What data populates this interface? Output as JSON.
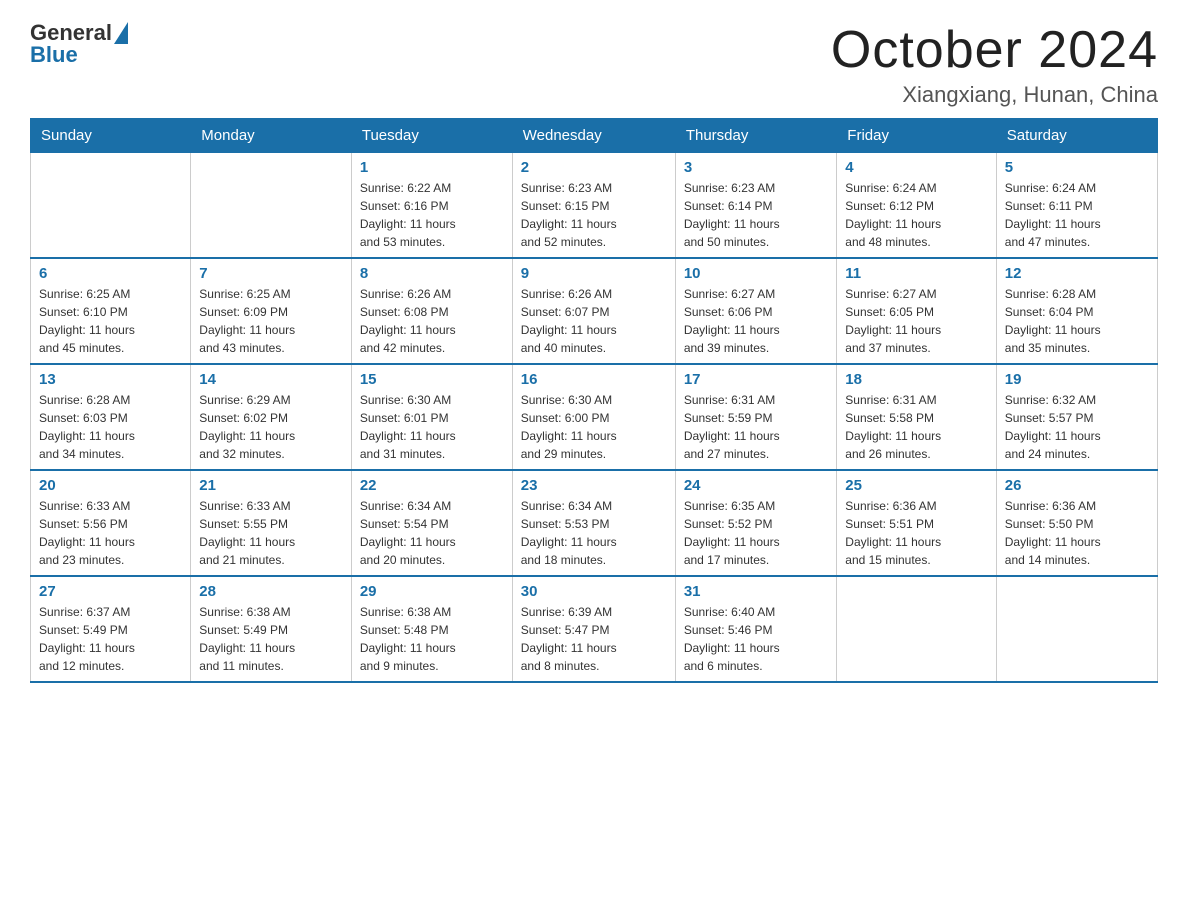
{
  "logo": {
    "general": "General",
    "blue": "Blue"
  },
  "header": {
    "title": "October 2024",
    "subtitle": "Xiangxiang, Hunan, China"
  },
  "days_of_week": [
    "Sunday",
    "Monday",
    "Tuesday",
    "Wednesday",
    "Thursday",
    "Friday",
    "Saturday"
  ],
  "weeks": [
    [
      {
        "day": "",
        "info": ""
      },
      {
        "day": "",
        "info": ""
      },
      {
        "day": "1",
        "info": "Sunrise: 6:22 AM\nSunset: 6:16 PM\nDaylight: 11 hours\nand 53 minutes."
      },
      {
        "day": "2",
        "info": "Sunrise: 6:23 AM\nSunset: 6:15 PM\nDaylight: 11 hours\nand 52 minutes."
      },
      {
        "day": "3",
        "info": "Sunrise: 6:23 AM\nSunset: 6:14 PM\nDaylight: 11 hours\nand 50 minutes."
      },
      {
        "day": "4",
        "info": "Sunrise: 6:24 AM\nSunset: 6:12 PM\nDaylight: 11 hours\nand 48 minutes."
      },
      {
        "day": "5",
        "info": "Sunrise: 6:24 AM\nSunset: 6:11 PM\nDaylight: 11 hours\nand 47 minutes."
      }
    ],
    [
      {
        "day": "6",
        "info": "Sunrise: 6:25 AM\nSunset: 6:10 PM\nDaylight: 11 hours\nand 45 minutes."
      },
      {
        "day": "7",
        "info": "Sunrise: 6:25 AM\nSunset: 6:09 PM\nDaylight: 11 hours\nand 43 minutes."
      },
      {
        "day": "8",
        "info": "Sunrise: 6:26 AM\nSunset: 6:08 PM\nDaylight: 11 hours\nand 42 minutes."
      },
      {
        "day": "9",
        "info": "Sunrise: 6:26 AM\nSunset: 6:07 PM\nDaylight: 11 hours\nand 40 minutes."
      },
      {
        "day": "10",
        "info": "Sunrise: 6:27 AM\nSunset: 6:06 PM\nDaylight: 11 hours\nand 39 minutes."
      },
      {
        "day": "11",
        "info": "Sunrise: 6:27 AM\nSunset: 6:05 PM\nDaylight: 11 hours\nand 37 minutes."
      },
      {
        "day": "12",
        "info": "Sunrise: 6:28 AM\nSunset: 6:04 PM\nDaylight: 11 hours\nand 35 minutes."
      }
    ],
    [
      {
        "day": "13",
        "info": "Sunrise: 6:28 AM\nSunset: 6:03 PM\nDaylight: 11 hours\nand 34 minutes."
      },
      {
        "day": "14",
        "info": "Sunrise: 6:29 AM\nSunset: 6:02 PM\nDaylight: 11 hours\nand 32 minutes."
      },
      {
        "day": "15",
        "info": "Sunrise: 6:30 AM\nSunset: 6:01 PM\nDaylight: 11 hours\nand 31 minutes."
      },
      {
        "day": "16",
        "info": "Sunrise: 6:30 AM\nSunset: 6:00 PM\nDaylight: 11 hours\nand 29 minutes."
      },
      {
        "day": "17",
        "info": "Sunrise: 6:31 AM\nSunset: 5:59 PM\nDaylight: 11 hours\nand 27 minutes."
      },
      {
        "day": "18",
        "info": "Sunrise: 6:31 AM\nSunset: 5:58 PM\nDaylight: 11 hours\nand 26 minutes."
      },
      {
        "day": "19",
        "info": "Sunrise: 6:32 AM\nSunset: 5:57 PM\nDaylight: 11 hours\nand 24 minutes."
      }
    ],
    [
      {
        "day": "20",
        "info": "Sunrise: 6:33 AM\nSunset: 5:56 PM\nDaylight: 11 hours\nand 23 minutes."
      },
      {
        "day": "21",
        "info": "Sunrise: 6:33 AM\nSunset: 5:55 PM\nDaylight: 11 hours\nand 21 minutes."
      },
      {
        "day": "22",
        "info": "Sunrise: 6:34 AM\nSunset: 5:54 PM\nDaylight: 11 hours\nand 20 minutes."
      },
      {
        "day": "23",
        "info": "Sunrise: 6:34 AM\nSunset: 5:53 PM\nDaylight: 11 hours\nand 18 minutes."
      },
      {
        "day": "24",
        "info": "Sunrise: 6:35 AM\nSunset: 5:52 PM\nDaylight: 11 hours\nand 17 minutes."
      },
      {
        "day": "25",
        "info": "Sunrise: 6:36 AM\nSunset: 5:51 PM\nDaylight: 11 hours\nand 15 minutes."
      },
      {
        "day": "26",
        "info": "Sunrise: 6:36 AM\nSunset: 5:50 PM\nDaylight: 11 hours\nand 14 minutes."
      }
    ],
    [
      {
        "day": "27",
        "info": "Sunrise: 6:37 AM\nSunset: 5:49 PM\nDaylight: 11 hours\nand 12 minutes."
      },
      {
        "day": "28",
        "info": "Sunrise: 6:38 AM\nSunset: 5:49 PM\nDaylight: 11 hours\nand 11 minutes."
      },
      {
        "day": "29",
        "info": "Sunrise: 6:38 AM\nSunset: 5:48 PM\nDaylight: 11 hours\nand 9 minutes."
      },
      {
        "day": "30",
        "info": "Sunrise: 6:39 AM\nSunset: 5:47 PM\nDaylight: 11 hours\nand 8 minutes."
      },
      {
        "day": "31",
        "info": "Sunrise: 6:40 AM\nSunset: 5:46 PM\nDaylight: 11 hours\nand 6 minutes."
      },
      {
        "day": "",
        "info": ""
      },
      {
        "day": "",
        "info": ""
      }
    ]
  ]
}
